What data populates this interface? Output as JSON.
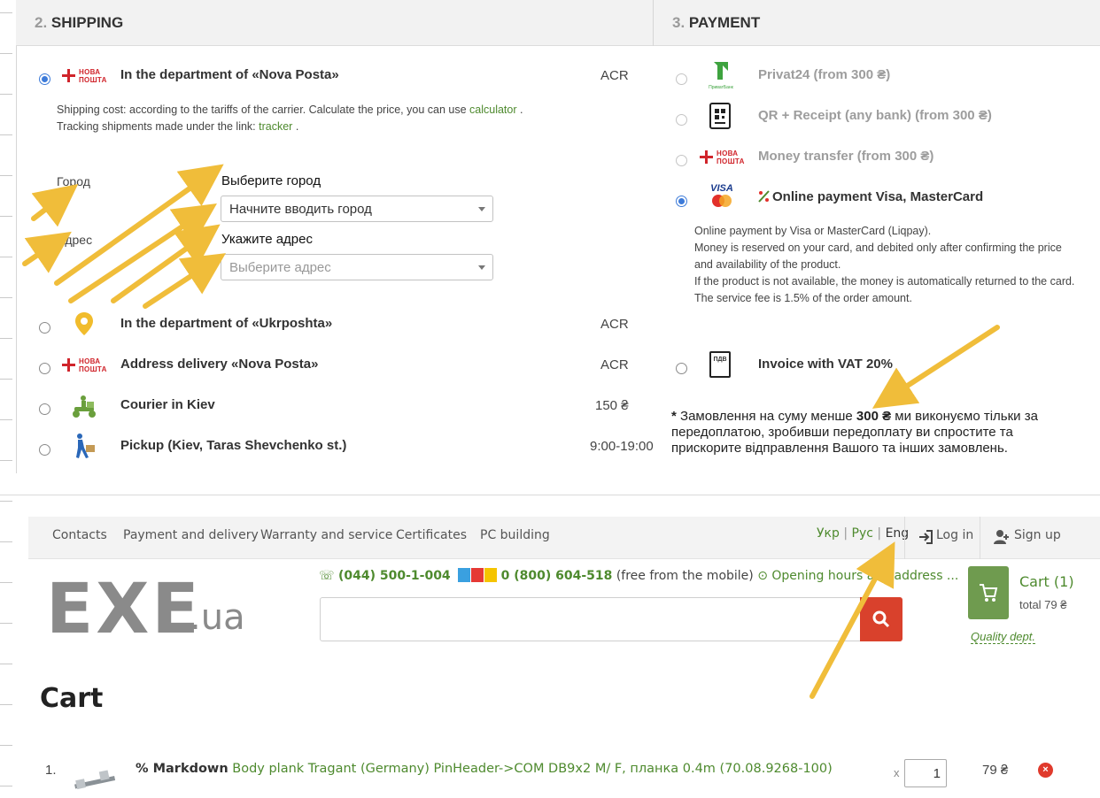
{
  "shipping": {
    "header_num": "2.",
    "header_title": "SHIPPING",
    "options": [
      {
        "title": "In the department of «Nova Posta»",
        "price": "ACR",
        "selected": true,
        "icon": "nova-poshta-logo"
      },
      {
        "title": "In the department of «Ukrposhta»",
        "price": "ACR",
        "selected": false,
        "icon": "map-pin-icon"
      },
      {
        "title": "Address delivery «Nova Posta»",
        "price": "ACR",
        "selected": false,
        "icon": "nova-poshta-logo"
      },
      {
        "title": "Courier in Kiev",
        "price": "150 ₴",
        "selected": false,
        "icon": "courier-scooter-icon"
      },
      {
        "title": "Pickup (Kiev, Taras Shevchenko st.)",
        "price": "9:00-19:00",
        "selected": false,
        "icon": "walking-person-icon"
      }
    ],
    "cost_text": "Shipping cost: according to the tariffs of the carrier. Calculate the price, you can use",
    "calculator_link": "calculator",
    "cost_end": ".",
    "tracking_text": "Tracking shipments made under the link:",
    "tracker_link": "tracker",
    "tracking_end": ".",
    "np_logo_line1": "НОВА",
    "np_logo_line2": "ПОШТА",
    "city_label": "Город",
    "city_title": "Выберите город",
    "city_select_value": "Начните вводить город",
    "address_label": "Адрес",
    "address_title": "Укажите адрес",
    "address_select_placeholder": "Выберите адрес"
  },
  "payment": {
    "header_num": "3.",
    "header_title": "PAYMENT",
    "options": [
      {
        "title": "Privat24 (from 300 ₴)",
        "selected": false,
        "enabled": false,
        "icon": "privatbank-logo"
      },
      {
        "title": "QR + Receipt (any bank) (from 300 ₴)",
        "selected": false,
        "enabled": false,
        "icon": "qr-receipt-icon"
      },
      {
        "title": "Money transfer (from 300 ₴)",
        "selected": false,
        "enabled": false,
        "icon": "nova-poshta-logo"
      },
      {
        "title": "Online payment Visa, MasterCard",
        "selected": true,
        "enabled": true,
        "icon": "visa-mastercard-logo"
      },
      {
        "title": "Invoice with VAT 20%",
        "selected": false,
        "enabled": true,
        "icon": "invoice-pdv-icon"
      }
    ],
    "privat_caption": "ПриватБанк",
    "visa_text": "VISA",
    "pdv_text": "ПДВ",
    "online_desc": [
      "Online payment by Visa or MasterCard (Liqpay).",
      "Money is reserved on your card, and debited only after confirming the price",
      "and availability of the product.",
      "If the product is not available, the money is automatically returned to the card.",
      "The service fee is 1.5% of the order amount."
    ],
    "note_star": "*",
    "note_pre": "Замовлення на суму менше",
    "note_amount": "300 ₴",
    "note_post": "ми виконуємо тільки за",
    "note_line2": "передоплатою, зробивши передоплату ви спростите та",
    "note_line3": "прискорите відправлення Вашого та інших замовлень."
  },
  "site": {
    "nav": [
      "Contacts",
      "Payment and delivery",
      "Warranty and service",
      "Certificates",
      "PC building"
    ],
    "lang_ukr": "Укр",
    "lang_rus": "Рус",
    "lang_eng": "Eng",
    "lang_sep": "|",
    "login": "Log in",
    "signup": "Sign up",
    "phone1": "(044) 500-1-004",
    "phone2": "0 (800) 604-518",
    "phone2_note": "(free from the mobile)",
    "hours_link": "Opening hours and address ...",
    "logo_main": "EXE",
    "logo_suffix": ".ua",
    "cart_label": "Cart (1)",
    "cart_total": "total 79 ₴",
    "quality_link": "Quality dept."
  },
  "cart": {
    "heading": "Cart",
    "items": [
      {
        "num": "1.",
        "badge": "% Markdown",
        "name": "Body plank Tragant (Germany) PinHeader->COM DB9x2 M/ F, планка 0.4m (70.08.9268-100)",
        "qty": "1",
        "qty_prefix": "x",
        "price": "79 ₴",
        "remove": "×"
      }
    ]
  },
  "colors": {
    "accent_green": "#4e8a2e",
    "radio_blue": "#3d7bd9",
    "search_red": "#d9412c",
    "annotation_arrow": "#f0bd3a"
  }
}
